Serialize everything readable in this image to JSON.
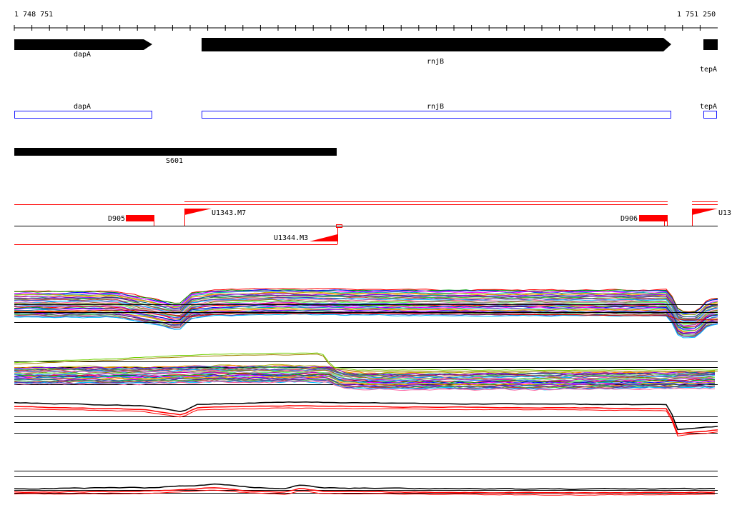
{
  "ruler": {
    "start_label": "1 748 751",
    "end_label": "1 751 250"
  },
  "genes": [
    {
      "name": "dapA",
      "strand": "+"
    },
    {
      "name": "rnjB",
      "strand": "+"
    },
    {
      "name": "tepA",
      "strand": "+"
    }
  ],
  "cds_boxes": [
    {
      "name": "dapA"
    },
    {
      "name": "rnjB"
    },
    {
      "name": "tepA"
    }
  ],
  "region": {
    "name": "S601"
  },
  "features": [
    {
      "name": "D905"
    },
    {
      "name": "U1343.M7"
    },
    {
      "name": "D906"
    },
    {
      "name": "U13"
    },
    {
      "name": "U1344.M3"
    }
  ],
  "colors": {
    "gene": "#000000",
    "cds_outline": "#1a1aff",
    "feature": "#ff0000",
    "axis": "#000000"
  },
  "tracks": [
    {
      "id": "expression-track-1"
    },
    {
      "id": "expression-track-2"
    },
    {
      "id": "expression-track-3"
    },
    {
      "id": "expression-track-4"
    }
  ]
}
